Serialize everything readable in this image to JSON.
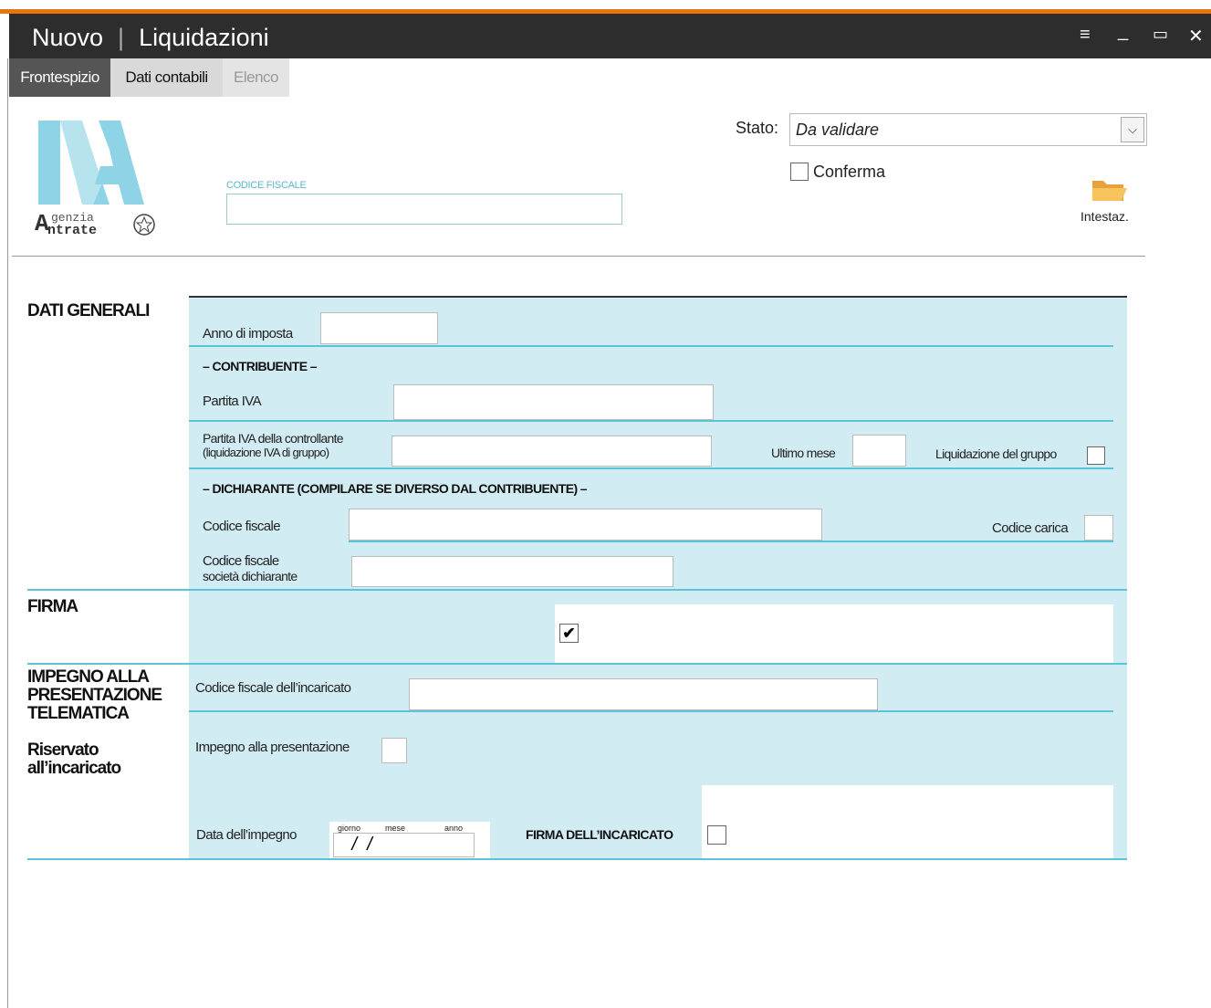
{
  "window": {
    "mode": "Nuovo",
    "title": "Liquidazioni",
    "separator": "|",
    "menu_glyph": "≡",
    "min_glyph": "_",
    "max_glyph": "▭",
    "close_glyph": "✕"
  },
  "tabs": [
    {
      "label": "Frontespizio",
      "active": true
    },
    {
      "label": "Dati contabili",
      "active": false
    },
    {
      "label": "Elenco",
      "active": false,
      "disabled": true
    }
  ],
  "logo": {
    "big": "IVA",
    "line1": "genzia",
    "line2": "ntrate",
    "initial": "A",
    "color": "#8fd3e6"
  },
  "header": {
    "codice_fiscale_label": "CODICE FISCALE",
    "codice_fiscale_value": "",
    "stato_label": "Stato:",
    "stato_value": "Da validare",
    "conferma_label": "Conferma",
    "conferma_checked": false,
    "intestaz_label": "Intestaz."
  },
  "dati_generali": {
    "title": "DATI GENERALI",
    "anno_label": "Anno di imposta",
    "anno_value": "",
    "contribuente_heading": "– CONTRIBUENTE –",
    "partita_iva_label": "Partita IVA",
    "partita_iva_value": "",
    "piva_controllante_line1": "Partita IVA della controllante",
    "piva_controllante_line2": "(liquidazione IVA di gruppo)",
    "piva_controllante_value": "",
    "ultimo_mese_label": "Ultimo mese",
    "ultimo_mese_value": "",
    "liquidazione_gruppo_label": "Liquidazione del gruppo",
    "liquidazione_gruppo_checked": false,
    "dichiarante_heading": "– DICHIARANTE (COMPILARE SE DIVERSO DAL CONTRIBUENTE) –",
    "codice_fiscale_label": "Codice fiscale",
    "codice_fiscale_value": "",
    "codice_carica_label": "Codice carica",
    "codice_carica_value": "",
    "cf_societa_line1": "Codice fiscale",
    "cf_societa_line2": "società dichiarante",
    "cf_societa_value": ""
  },
  "firma": {
    "title": "FIRMA",
    "checked": true,
    "check_glyph": "✔"
  },
  "impegno": {
    "title_line1": "IMPEGNO ALLA",
    "title_line2": "PRESENTAZIONE",
    "title_line3": "TELEMATICA",
    "riservato_line1": "Riservato",
    "riservato_line2": "all’incaricato",
    "cf_incaricato_label": "Codice fiscale dell’incaricato",
    "cf_incaricato_value": "",
    "impegno_presentazione_label": "Impegno alla presentazione",
    "impegno_presentazione_checked": false,
    "data_label": "Data dell’impegno",
    "data_giorno": "giorno",
    "data_mese": "mese",
    "data_anno": "anno",
    "data_value": " /  / ",
    "firma_incaricato_label": "FIRMA DELL’INCARICATO",
    "firma_incaricato_checked": false
  }
}
